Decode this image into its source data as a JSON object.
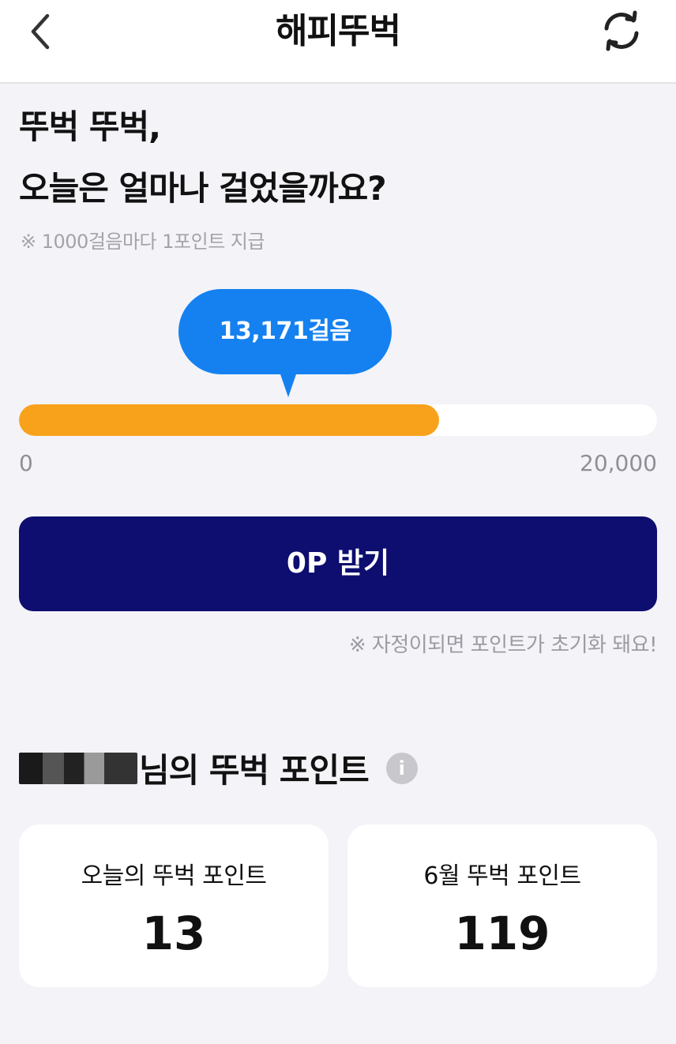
{
  "header": {
    "title": "해피뚜벅",
    "back_icon": "chevron-left-icon",
    "refresh_icon": "refresh-icon"
  },
  "headline": {
    "line1": "뚜벅 뚜벅,",
    "line2": "오늘은 얼마나 걸었을까요?"
  },
  "subnote": "※ 1000걸음마다 1포인트 지급",
  "steps": {
    "bubble_label": "13,171걸음",
    "current": 13171,
    "min_label": "0",
    "max_label": "20,000",
    "max": 20000,
    "progress_fraction": 0.6586
  },
  "claim_button": "0P 받기",
  "reset_note": "※ 자정이되면 포인트가 초기화 돼요!",
  "points_section": {
    "title": "님의 뚜벅 포인트",
    "info_glyph": "i",
    "cards": [
      {
        "label": "오늘의 뚜벅 포인트",
        "value": "13"
      },
      {
        "label": "6월 뚜벅 포인트",
        "value": "119"
      }
    ]
  },
  "colors": {
    "accent_blue": "#1581f0",
    "progress_orange": "#f8a21c",
    "button_navy": "#0d0e6f",
    "background": "#f3f3f8"
  }
}
